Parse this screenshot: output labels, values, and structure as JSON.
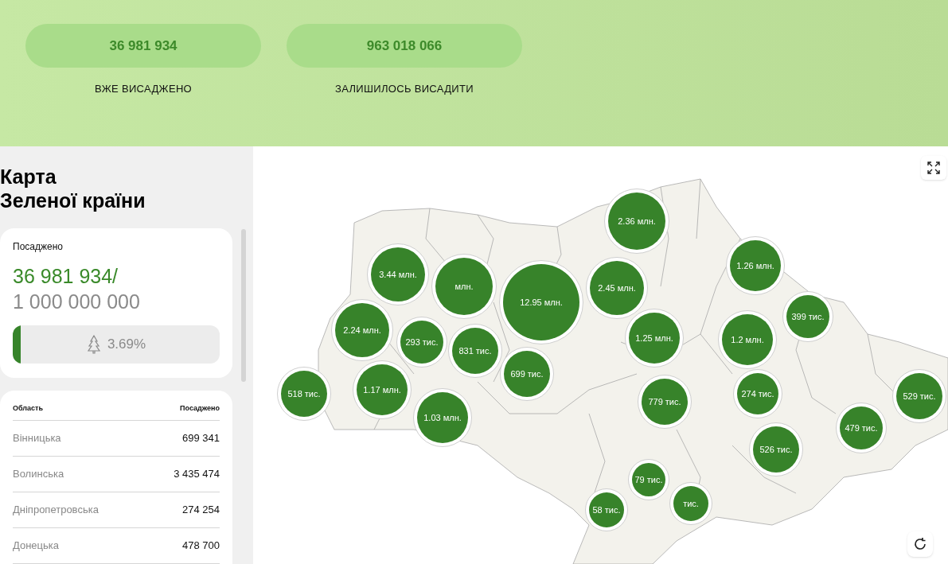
{
  "stats": [
    {
      "value": "36 981 934",
      "label": "ВЖЕ ВИСАДЖЕНО"
    },
    {
      "value": "963 018 066",
      "label": "ЗАЛИШИЛОСЬ ВИСАДИТИ"
    }
  ],
  "sidebar": {
    "title": "Карта\nЗеленої країни",
    "summary": {
      "label": "Посаджено",
      "planted": "36 981 934/",
      "goal": "1 000 000 000",
      "level": 0.0369,
      "percent": "3.69%"
    },
    "table": {
      "columns": [
        "Область",
        "Посаджено"
      ],
      "rows": [
        [
          "Вінницька",
          "699 341"
        ],
        [
          "Волинська",
          "3 435 474"
        ],
        [
          "Дніпропетровська",
          "274 254"
        ],
        [
          "Донецька",
          "478 700"
        ]
      ]
    }
  },
  "map": {
    "bubbles": [
      {
        "label": "2.36 млн."
      },
      {
        "label": "1.26 млн."
      },
      {
        "label": "3.44 млн."
      },
      {
        "label": "млн."
      },
      {
        "label": "12.95 млн."
      },
      {
        "label": "2.45 млн."
      },
      {
        "label": "399 тис."
      },
      {
        "label": "2.24 млн."
      },
      {
        "label": "293 тис."
      },
      {
        "label": "831 тис."
      },
      {
        "label": "699 тис."
      },
      {
        "label": "1.25 млн."
      },
      {
        "label": "1.2 млн."
      },
      {
        "label": "518 тис."
      },
      {
        "label": "1.17 млн."
      },
      {
        "label": "1.03 млн."
      },
      {
        "label": "779 тис."
      },
      {
        "label": "274 тис."
      },
      {
        "label": "526 тис."
      },
      {
        "label": "529 тис."
      },
      {
        "label": "479 тис."
      },
      {
        "label": "79 тис."
      },
      {
        "label": "тис."
      },
      {
        "label": "58 тис."
      }
    ]
  }
}
